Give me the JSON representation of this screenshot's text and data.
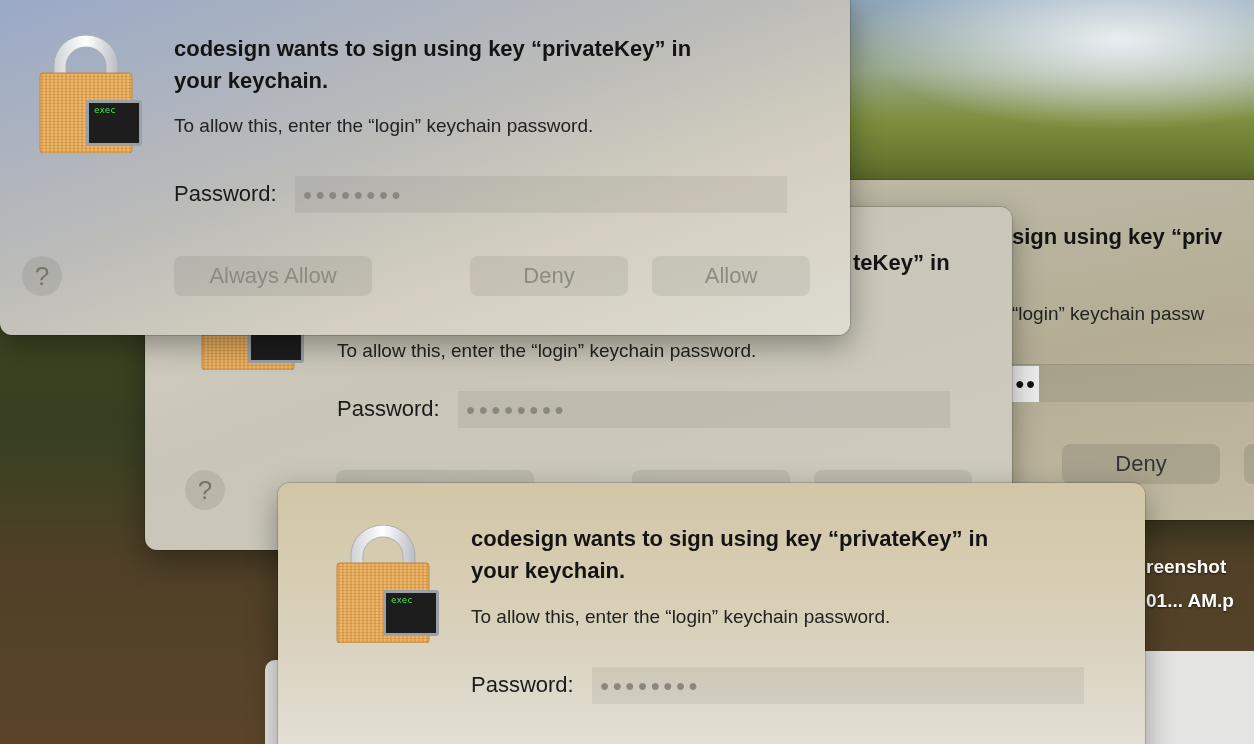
{
  "desktop": {
    "file_label_lines": [
      "reenshot",
      "01... AM.p"
    ]
  },
  "dialogs": [
    {
      "kind": "sheet-right",
      "title_fragment": "sign using key “priv",
      "message_fragment": "“login” keychain passw",
      "password_value": "●●",
      "buttons": [
        {
          "label": "Deny",
          "disabled": false
        }
      ]
    },
    {
      "kind": "sheet-back",
      "title_fragment": "teKey” in",
      "message": "To allow this, enter the “login” keychain password.",
      "password_label": "Password:",
      "password_value": "●●●●●●●●",
      "help": "?"
    },
    {
      "kind": "sheet-top",
      "icon_caption": "exec",
      "title": "codesign wants to sign using key “privateKey” in your keychain.",
      "message": "To allow this, enter the “login” keychain password.",
      "password_label": "Password:",
      "password_value": "●●●●●●●●",
      "help": "?",
      "buttons": [
        {
          "label": "Always Allow",
          "disabled": true
        },
        {
          "label": "Deny",
          "disabled": true
        },
        {
          "label": "Allow",
          "disabled": true
        }
      ]
    },
    {
      "kind": "sheet-front",
      "icon_caption": "exec",
      "title": "codesign wants to sign using key “privateKey” in your keychain.",
      "message": "To allow this, enter the “login” keychain password.",
      "password_label": "Password:",
      "password_value": "●●●●●●●●"
    }
  ]
}
